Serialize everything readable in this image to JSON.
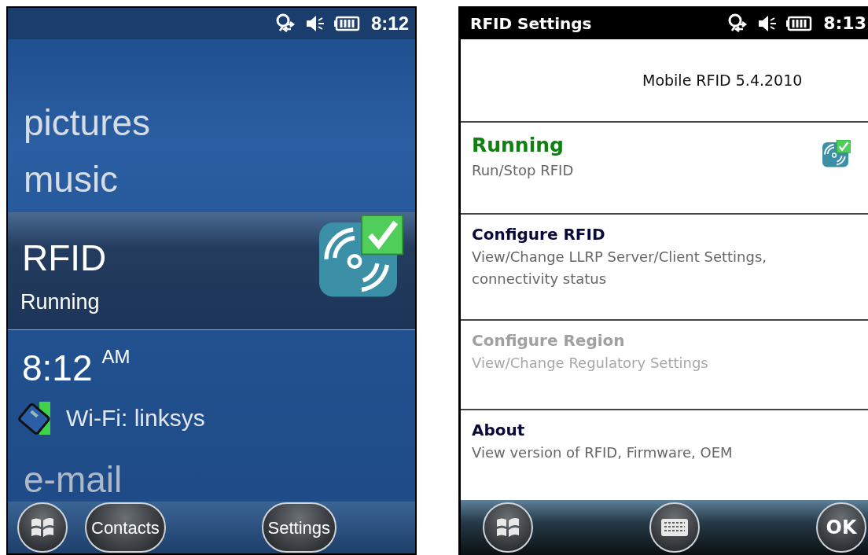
{
  "home_screen": {
    "status_bar": {
      "time": "8:12"
    },
    "items": [
      {
        "label": "pictures",
        "selected": false
      },
      {
        "label": "music",
        "selected": false
      },
      {
        "label": "RFID",
        "selected": true,
        "status": "Running"
      }
    ],
    "clock": {
      "time": "8:12",
      "suffix": "AM"
    },
    "wifi": "Wi-Fi: linksys",
    "next_item": "e-mail",
    "softkeys": [
      "Contacts",
      "Settings"
    ]
  },
  "settings_screen": {
    "title": "RFID Settings",
    "status_bar": {
      "time": "8:13"
    },
    "version": "Mobile RFID 5.4.2010",
    "entries": [
      {
        "kind": "status",
        "title": "Running",
        "subtitle": "Run/Stop RFID",
        "disabled": false
      },
      {
        "kind": "link",
        "title": "Configure RFID",
        "subtitle": "View/Change LLRP Server/Client Settings, connectivity status",
        "disabled": false
      },
      {
        "kind": "link",
        "title": "Configure Region",
        "subtitle": "View/Change Regulatory Settings",
        "disabled": true
      },
      {
        "kind": "link",
        "title": "About",
        "subtitle": "View version of RFID, Firmware, OEM",
        "disabled": false
      }
    ],
    "softkeys": [
      "OK"
    ]
  }
}
